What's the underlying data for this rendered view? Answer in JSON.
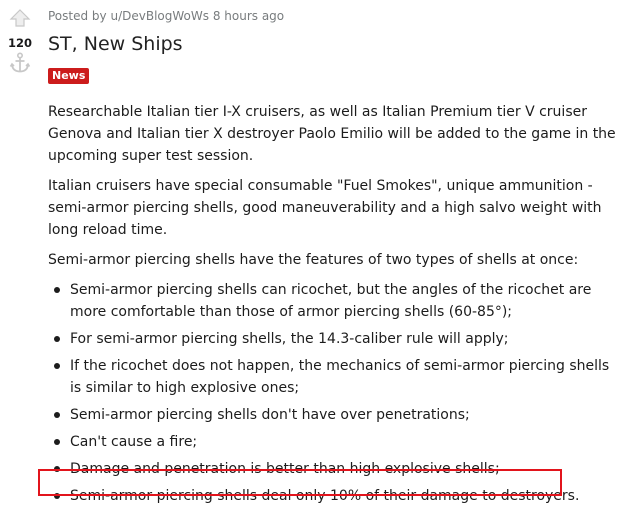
{
  "vote": {
    "count": "120",
    "upvote_icon": "upvote-arrow-icon",
    "downvote_icon": "anchor-downvote-icon"
  },
  "post": {
    "meta_prefix": "Posted by ",
    "author": "u/DevBlogWoWs",
    "time": " 8 hours ago",
    "title": "ST, New Ships",
    "flair": "News",
    "flair_color": "#cc1c1c",
    "paragraphs": [
      "Researchable Italian tier I-X cruisers, as well as Italian Premium tier V cruiser Genova and Italian tier X destroyer Paolo Emilio will be added to the game in the upcoming super test session.",
      "Italian cruisers have special consumable \"Fuel Smokes\", unique ammunition - semi-armor piercing shells, good maneuverability and a high salvo weight with long reload time.",
      "Semi-armor piercing shells have the features of two types of shells at once:"
    ],
    "bullets": [
      "Semi-armor piercing shells can ricochet, but the angles of the ricochet are more comfortable than those of armor piercing shells (60-85°);",
      "For semi-armor piercing shells, the 14.3-caliber rule will apply;",
      "If the ricochet does not happen, the mechanics of semi-armor piercing shells is similar to high explosive ones;",
      "Semi-armor piercing shells don't have over penetrations;",
      "Can't cause a fire;",
      "Damage and penetration is better than high explosive shells;",
      "Semi-armor piercing shells deal only 10% of their damage to destroyers."
    ],
    "highlight_color": "#e2141c"
  }
}
